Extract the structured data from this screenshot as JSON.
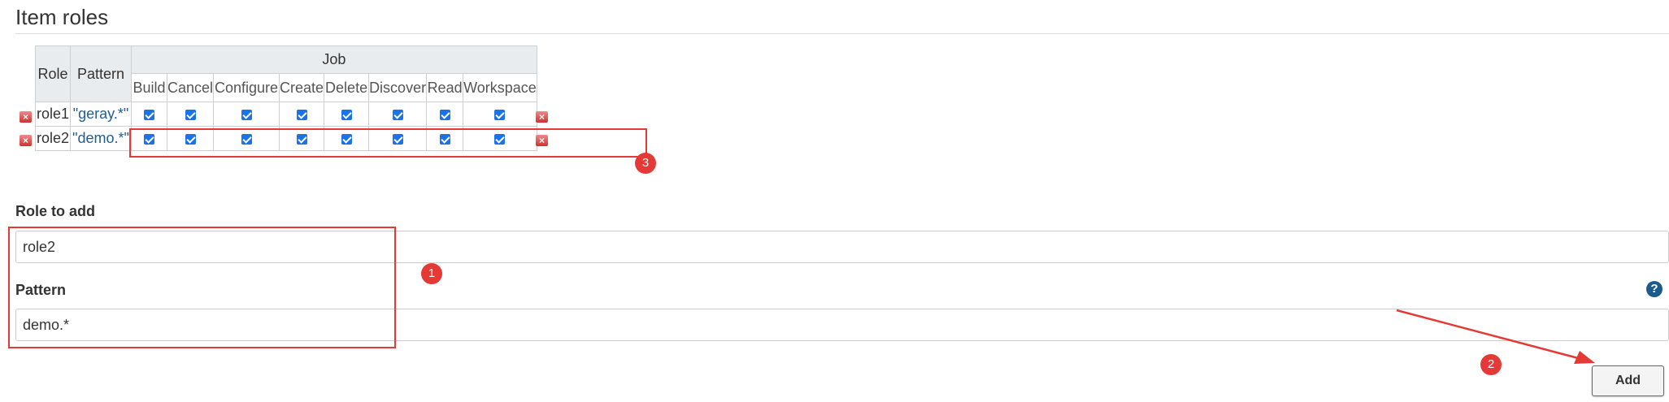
{
  "section": {
    "title": "Item roles"
  },
  "table": {
    "headers": {
      "role": "Role",
      "pattern": "Pattern",
      "group": "Job"
    },
    "permissions": [
      "Build",
      "Cancel",
      "Configure",
      "Create",
      "Delete",
      "Discover",
      "Read",
      "Workspace"
    ],
    "rows": [
      {
        "role": "role1",
        "pattern": "\"geray.*\"",
        "checked": [
          true,
          true,
          true,
          true,
          true,
          true,
          true,
          true
        ]
      },
      {
        "role": "role2",
        "pattern": "\"demo.*\"",
        "checked": [
          true,
          true,
          true,
          true,
          true,
          true,
          true,
          true
        ]
      }
    ],
    "delete_icon": "delete-icon"
  },
  "form": {
    "role_label": "Role to add",
    "role_value": "role2",
    "pattern_label": "Pattern",
    "pattern_value": "demo.*",
    "help_icon": "question-mark-icon",
    "add_button": "Add"
  },
  "annotations": {
    "badge1": "1",
    "badge2": "2",
    "badge3": "3"
  },
  "colors": {
    "annotation": "#e53935",
    "checkbox": "#1a73e8",
    "pattern_text": "#1f5e93"
  }
}
